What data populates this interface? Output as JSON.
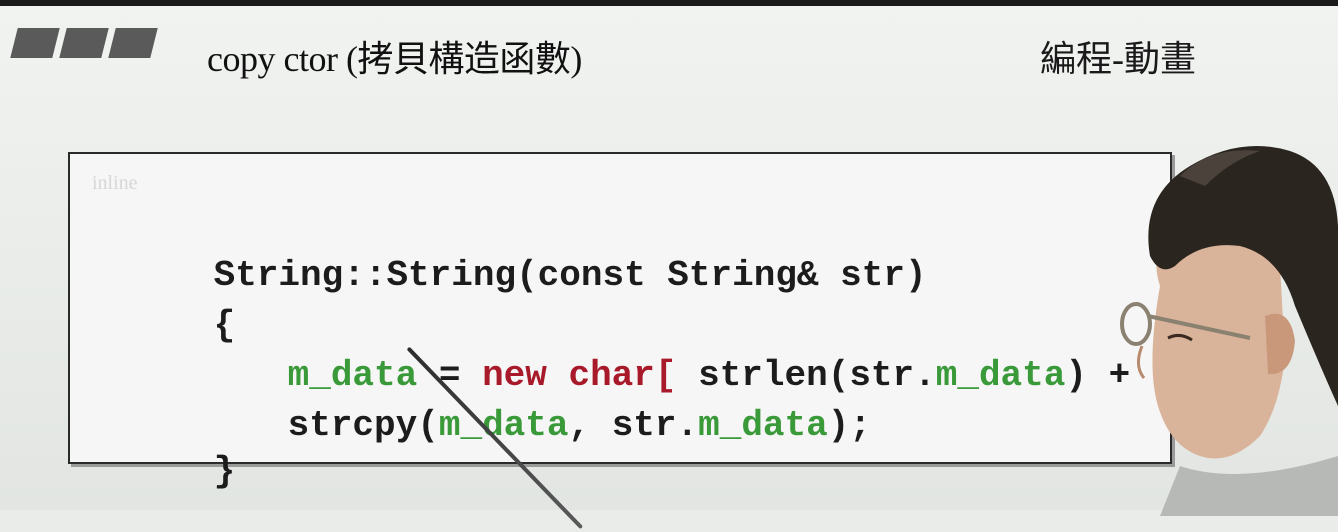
{
  "slide": {
    "title": "copy ctor (拷貝構造函數)",
    "section": "編程-動畫"
  },
  "code_box": {
    "ghost_label": "inline",
    "lines": [
      {
        "tokens": [
          {
            "text": "String::String(const String& str)",
            "style": "plain"
          }
        ]
      },
      {
        "tokens": [
          {
            "text": "{",
            "style": "plain"
          }
        ]
      },
      {
        "tokens": [
          {
            "text": "m_data",
            "style": "green"
          },
          {
            "text": " = ",
            "style": "plain"
          },
          {
            "text": "new char[",
            "style": "red"
          },
          {
            "text": " strlen(str.",
            "style": "plain"
          },
          {
            "text": "m_data",
            "style": "green"
          },
          {
            "text": ") + ",
            "style": "plain"
          }
        ]
      },
      {
        "tokens": [
          {
            "text": "strcpy(",
            "style": "plain"
          },
          {
            "text": "m_data",
            "style": "green"
          },
          {
            "text": ", str.",
            "style": "plain"
          },
          {
            "text": "m_data",
            "style": "green"
          },
          {
            "text": ");",
            "style": "plain"
          }
        ]
      },
      {
        "tokens": [
          {
            "text": "}",
            "style": "plain"
          }
        ]
      }
    ]
  },
  "colors": {
    "keyword_red": "#a8192a",
    "member_green": "#3a9a3a",
    "text_dark": "#1c1c1c",
    "accent_bars": "#5a5a5a"
  },
  "icons": {
    "header_decoration": "slanted-bars-icon",
    "pointer": "laser-pointer-stick",
    "presenter": "presenter-person"
  }
}
